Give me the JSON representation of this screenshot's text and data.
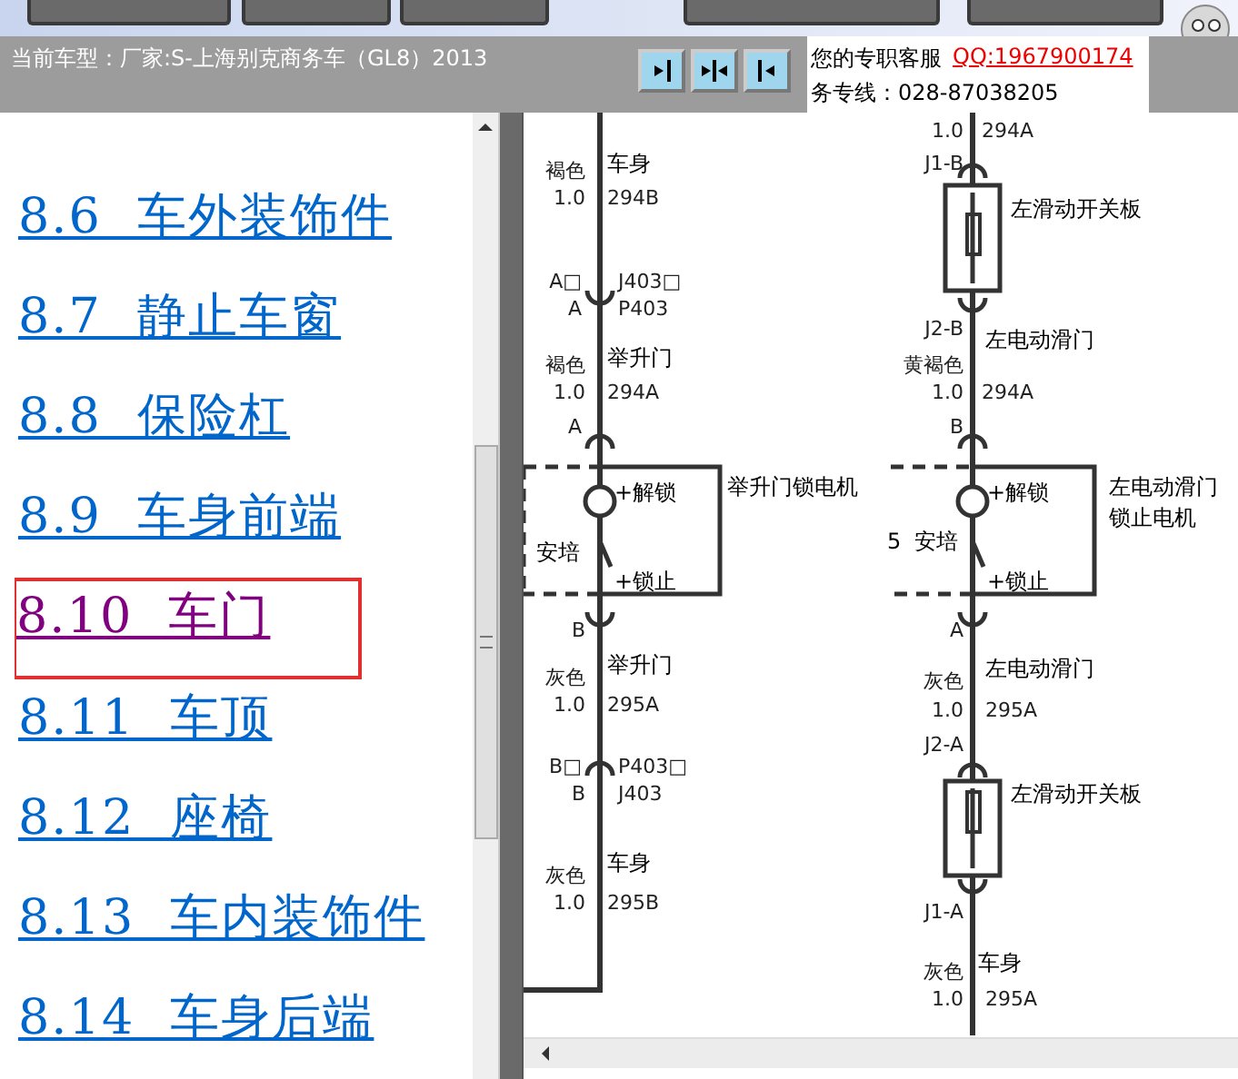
{
  "info_bar": {
    "vehicle": "当前车型：厂家:S-上海别克商务车（GL8）2013",
    "service_label": "您的专职客服",
    "qq_link": "QQ:1967900174",
    "hotline": "务专线：028-87038205"
  },
  "sidebar": {
    "items": [
      {
        "label": "8.6 车外装饰件",
        "selected": false
      },
      {
        "label": "8.7 静止车窗",
        "selected": false
      },
      {
        "label": "8.8 保险杠",
        "selected": false
      },
      {
        "label": "8.9 车身前端",
        "selected": false
      },
      {
        "label": "8.10 车门",
        "selected": true
      },
      {
        "label": "8.11 车顶",
        "selected": false
      },
      {
        "label": "8.12 座椅",
        "selected": false
      },
      {
        "label": "8.13 车内装饰件",
        "selected": false
      },
      {
        "label": "8.14 车身后端",
        "selected": false
      }
    ]
  },
  "diagram": {
    "labels": [
      {
        "text": "褐色",
        "kind": "wire"
      },
      {
        "text": "车身",
        "kind": "name"
      },
      {
        "text": "1.0",
        "kind": "wire"
      },
      {
        "text": "294B",
        "kind": "wire"
      },
      {
        "text": "A□",
        "kind": "wire"
      },
      {
        "text": "J403□",
        "kind": "wire"
      },
      {
        "text": "A",
        "kind": "wire"
      },
      {
        "text": "P403",
        "kind": "wire"
      },
      {
        "text": "褐色",
        "kind": "wire"
      },
      {
        "text": "举升门",
        "kind": "name"
      },
      {
        "text": "1.0",
        "kind": "wire"
      },
      {
        "text": "294A",
        "kind": "wire"
      },
      {
        "text": "A",
        "kind": "wire"
      },
      {
        "text": "+解锁",
        "kind": "name"
      },
      {
        "text": "举升门锁电机",
        "kind": "name"
      },
      {
        "text": "安培",
        "kind": "name"
      },
      {
        "text": "+锁止",
        "kind": "name"
      },
      {
        "text": "B",
        "kind": "wire"
      },
      {
        "text": "灰色",
        "kind": "wire"
      },
      {
        "text": "举升门",
        "kind": "name"
      },
      {
        "text": "1.0",
        "kind": "wire"
      },
      {
        "text": "295A",
        "kind": "wire"
      },
      {
        "text": "B□",
        "kind": "wire"
      },
      {
        "text": "P403□",
        "kind": "wire"
      },
      {
        "text": "B",
        "kind": "wire"
      },
      {
        "text": "J403",
        "kind": "wire"
      },
      {
        "text": "灰色",
        "kind": "wire"
      },
      {
        "text": "车身",
        "kind": "name"
      },
      {
        "text": "1.0",
        "kind": "wire"
      },
      {
        "text": "295B",
        "kind": "wire"
      },
      {
        "text": "1.0",
        "kind": "wire"
      },
      {
        "text": "294A",
        "kind": "wire"
      },
      {
        "text": "J1-B",
        "kind": "wire"
      },
      {
        "text": "左滑动开关板",
        "kind": "name"
      },
      {
        "text": "J2-B",
        "kind": "wire"
      },
      {
        "text": "左电动滑门",
        "kind": "name"
      },
      {
        "text": "黄褐色",
        "kind": "wire"
      },
      {
        "text": "1.0",
        "kind": "wire"
      },
      {
        "text": "294A",
        "kind": "wire"
      },
      {
        "text": "B",
        "kind": "wire"
      },
      {
        "text": "+解锁",
        "kind": "name"
      },
      {
        "text": "左电动滑门",
        "kind": "name"
      },
      {
        "text": "锁止电机",
        "kind": "name"
      },
      {
        "text": "5",
        "kind": "name"
      },
      {
        "text": "安培",
        "kind": "name"
      },
      {
        "text": "+锁止",
        "kind": "name"
      },
      {
        "text": "A",
        "kind": "wire"
      },
      {
        "text": "左电动滑门",
        "kind": "name"
      },
      {
        "text": "灰色",
        "kind": "wire"
      },
      {
        "text": "1.0",
        "kind": "wire"
      },
      {
        "text": "295A",
        "kind": "wire"
      },
      {
        "text": "J2-A",
        "kind": "wire"
      },
      {
        "text": "左滑动开关板",
        "kind": "name"
      },
      {
        "text": "J1-A",
        "kind": "wire"
      },
      {
        "text": "灰色",
        "kind": "wire"
      },
      {
        "text": "车身",
        "kind": "name"
      },
      {
        "text": "1.0",
        "kind": "wire"
      },
      {
        "text": "295A",
        "kind": "wire"
      }
    ]
  }
}
